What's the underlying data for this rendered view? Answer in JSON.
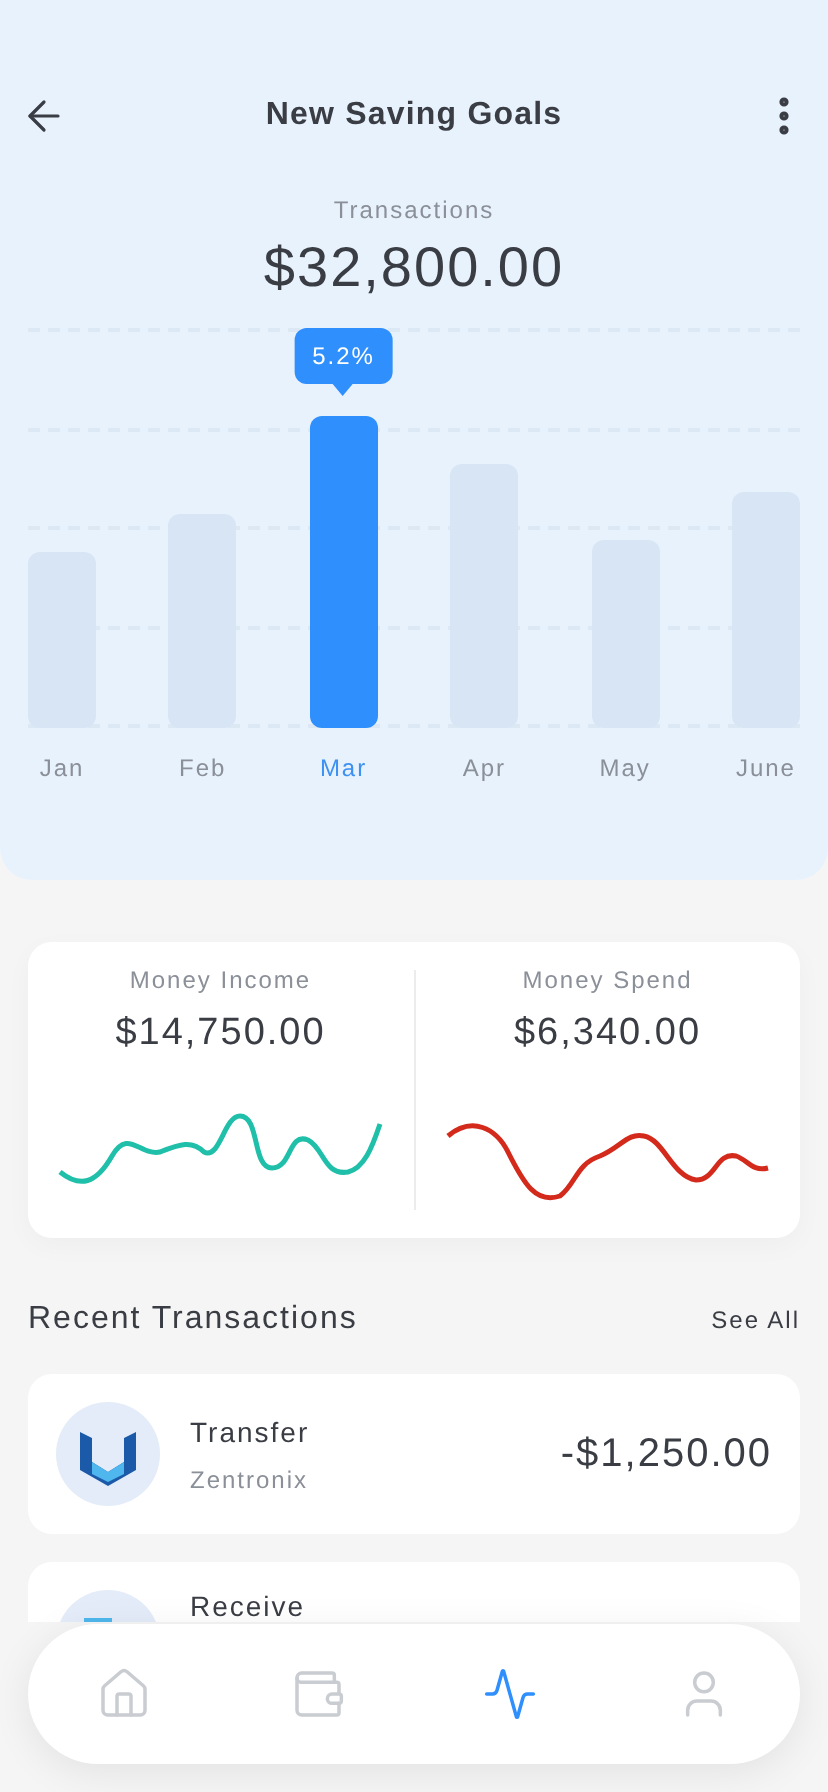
{
  "header": {
    "title": "New Saving Goals"
  },
  "summary": {
    "label": "Transactions",
    "amount": "$32,800.00"
  },
  "bar_chart": {
    "tooltip": "5.2%",
    "months": [
      {
        "label": "Jan",
        "selected": false
      },
      {
        "label": "Feb",
        "selected": false
      },
      {
        "label": "Mar",
        "selected": true
      },
      {
        "label": "Apr",
        "selected": false
      },
      {
        "label": "May",
        "selected": false
      },
      {
        "label": "June",
        "selected": false
      }
    ]
  },
  "stats": [
    {
      "kind": "income",
      "label": "Money Income",
      "amount": "$14,750.00",
      "color": "#20bfa9"
    },
    {
      "kind": "spend",
      "label": "Money Spend",
      "amount": "$6,340.00",
      "color": "#d42a1c"
    }
  ],
  "recent": {
    "title": "Recent Transactions",
    "link": "See All",
    "items": [
      {
        "title": "Transfer",
        "subtitle": "Zentronix",
        "amount": "-$1,250.00"
      },
      {
        "title": "Receive"
      }
    ]
  },
  "nav": [
    {
      "kind": "home",
      "selected": false
    },
    {
      "kind": "wallet",
      "selected": false
    },
    {
      "kind": "activity",
      "selected": true
    },
    {
      "kind": "profile",
      "selected": false
    }
  ]
}
